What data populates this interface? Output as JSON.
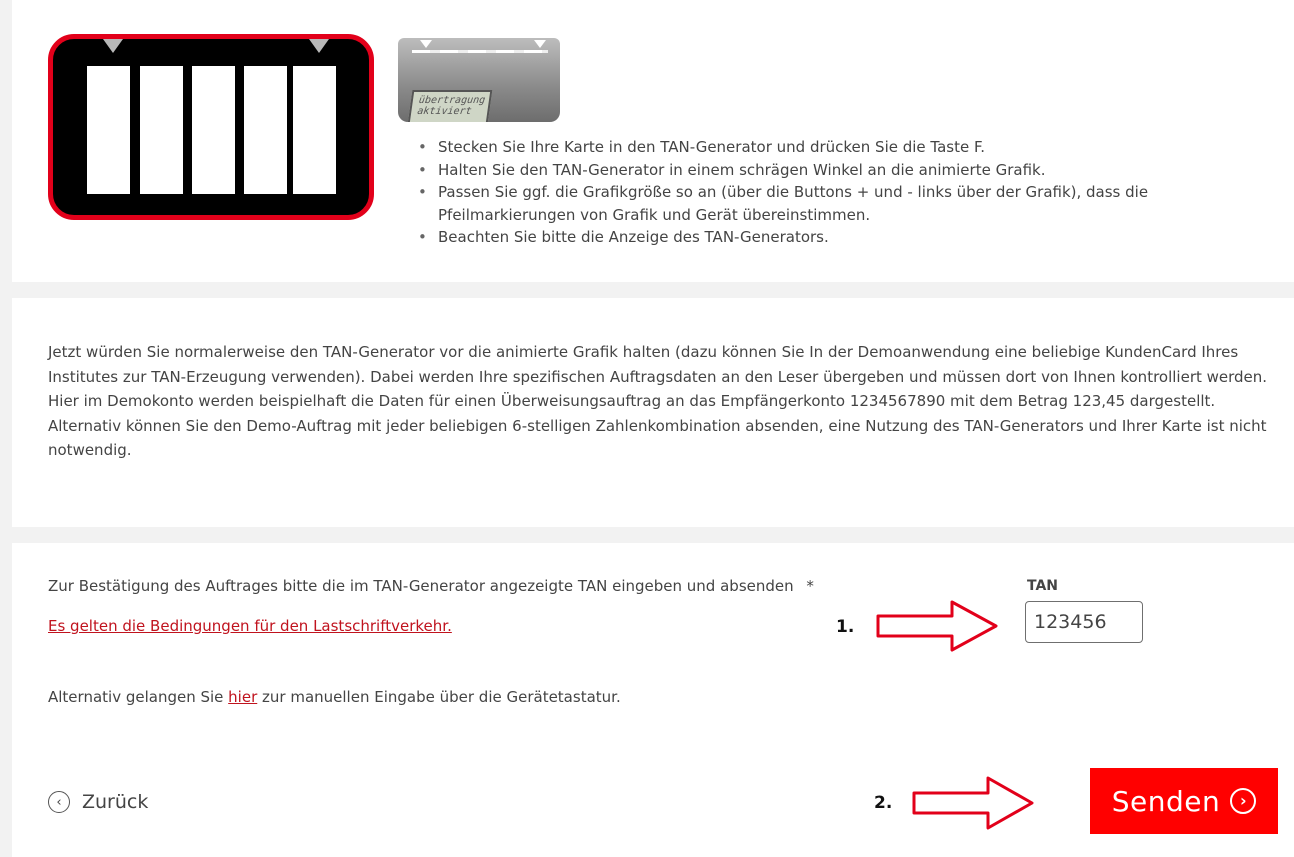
{
  "device_lcd": "übertragung\naktiviert",
  "instructions": [
    "Stecken Sie Ihre Karte in den TAN-Generator und drücken Sie die Taste F.",
    "Halten Sie den TAN-Generator in einem schrägen Winkel an die animierte Grafik.",
    "Passen Sie ggf. die Grafikgröße so an (über die Buttons + und - links über der Grafik), dass die Pfeilmarkierungen von Grafik und Gerät übereinstimmen.",
    "Beachten Sie bitte die Anzeige des TAN-Generators."
  ],
  "explanation": {
    "paragraph1": "Jetzt würden Sie normalerweise den TAN-Generator vor die animierte Grafik halten (dazu können Sie In der Demoanwendung eine beliebige KundenCard Ihres Institutes zur TAN-Erzeugung verwenden). Dabei werden Ihre spezifischen Auftragsdaten an den Leser übergeben und müssen dort von Ihnen kontrolliert werden. Hier im Demokonto werden beispielhaft die Daten für einen Überweisungsauftrag an das Empfängerkonto 1234567890 mit dem Betrag 123,45 dargestellt.",
    "paragraph2": "Alternativ können Sie den Demo-Auftrag mit jeder beliebigen 6-stelligen Zahlenkombination absenden, eine Nutzung des TAN-Generators und Ihrer Karte ist nicht notwendig."
  },
  "confirm": {
    "label": "Zur Bestätigung des Auftrages bitte die im TAN-Generator angezeigte TAN eingeben und absenden",
    "required_mark": "*",
    "terms_link": "Es gelten die Bedingungen für den Lastschriftverkehr."
  },
  "tan": {
    "label": "TAN",
    "value": "123456"
  },
  "annotations": {
    "step1": "1.",
    "step2": "2."
  },
  "alternative": {
    "before": "Alternativ gelangen Sie ",
    "link": "hier",
    "after": " zur manuellen Eingabe über die Gerätetastatur."
  },
  "buttons": {
    "back": "Zurück",
    "send": "Senden"
  },
  "colors": {
    "accent_red": "#ff0000",
    "link_red": "#c0131e",
    "frame_red": "#e2001a",
    "text": "#444444",
    "divider": "#f2f2f2"
  },
  "icons": {
    "back": "chevron-left-circle-icon",
    "send": "chevron-right-circle-icon"
  }
}
